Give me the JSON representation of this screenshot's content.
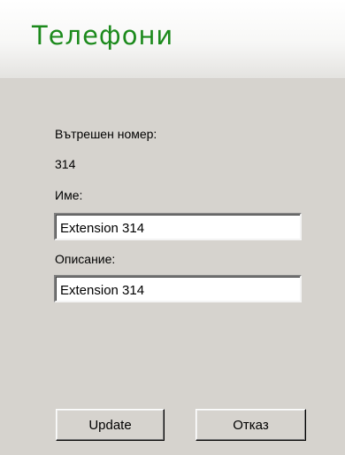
{
  "header": {
    "title": "Телефони"
  },
  "form": {
    "extension_label": "Вътрешен номер:",
    "extension_value": "314",
    "name_label": "Име:",
    "name_value": "Extension 314",
    "description_label": "Описание:",
    "description_value": "Extension 314"
  },
  "buttons": {
    "update_label": "Update",
    "cancel_label": "Отказ"
  },
  "colors": {
    "title_green": "#1c8a1c",
    "panel_gray": "#d6d3ce"
  }
}
